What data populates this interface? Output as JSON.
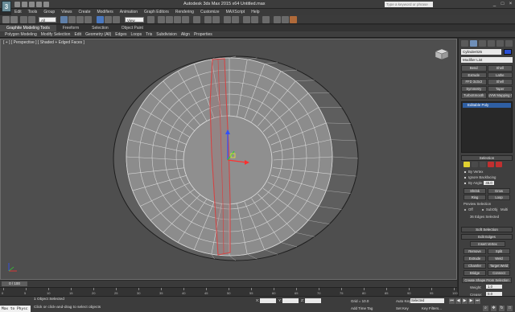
{
  "window": {
    "title": "Autodesk 3ds Max 2015 x64    Untitled.max",
    "search_placeholder": "Type a keyword or phrase",
    "controls": [
      "_",
      "□",
      "×"
    ]
  },
  "menu": [
    "Edit",
    "Tools",
    "Group",
    "Views",
    "Create",
    "Modifiers",
    "Animation",
    "Graph Editors",
    "Rendering",
    "Customize",
    "MAXScript",
    "Help"
  ],
  "toolbar": {
    "selection_filter": "All",
    "view_combo": "View"
  },
  "ribbon": {
    "tabs": [
      "Graphite Modeling Tools",
      "Freeform",
      "Selection",
      "Object Paint"
    ],
    "items": [
      "Polygon Modeling",
      "Modify Selection",
      "Edit",
      "Geometry (All)",
      "Edges",
      "Loops",
      "Tris",
      "Subdivision",
      "Align",
      "Properties"
    ]
  },
  "viewport": {
    "label": "[ + ] [ Perspective ] [ Shaded + Edged Faces ]"
  },
  "command_panel": {
    "object_name": "Cylinder025",
    "modifier_list": "Modifier List",
    "modifier_buttons": [
      "Bend",
      "Shell",
      "Extrude",
      "Lathe",
      "FFD 3x3x3",
      "Shell",
      "Symmetry",
      "Taper",
      "TurboSmooth",
      "UVW Mapping Cle"
    ],
    "stack_item": "Editable Poly",
    "selection_header": "Selection",
    "by_vertex": "By Vertex",
    "ignore_backfacing": "Ignore Backfacing",
    "by_angle": "By Angle:",
    "by_angle_value": "45.0",
    "shrink": "Shrink",
    "grow": "Grow",
    "ring": "Ring",
    "loop": "Loop",
    "preview_selection": "Preview Selection",
    "preview_off": "Off",
    "preview_subobj": "SubObj",
    "preview_multi": "Multi",
    "edges_selected": "36 Edges Selected",
    "soft_selection": "Soft Selection",
    "edit_edges": "Edit Edges",
    "insert_vertex": "Insert Vertex",
    "remove": "Remove",
    "split": "Split",
    "extrude": "Extrude",
    "weld": "Weld",
    "chamfer": "Chamfer",
    "target_weld": "Target Weld",
    "bridge": "Bridge",
    "connect": "Connect",
    "create_shape": "Create Shape From Selection",
    "weight_label": "Weight:",
    "weight_value": "1.0",
    "crease_label": "Crease:",
    "crease_value": "0.0"
  },
  "timeline": {
    "slider": "0 / 100",
    "ticks": [
      "0",
      "5",
      "10",
      "15",
      "20",
      "25",
      "30",
      "35",
      "40",
      "45",
      "50",
      "55",
      "60",
      "65",
      "70",
      "75",
      "80",
      "85",
      "90",
      "95",
      "100"
    ]
  },
  "status": {
    "maxscript": "Max to Physc",
    "object_selected": "1 Object Selected",
    "prompt": "Click or click-and-drag to select objects",
    "x_label": "X:",
    "y_label": "Y:",
    "z_label": "Z:",
    "grid": "Grid = 10.0",
    "auto_key": "Auto Key",
    "selected": "Selected",
    "set_key": "Set Key",
    "key_filters": "Key Filters...",
    "add_time_tag": "Add Time Tag"
  },
  "colors": {
    "viewport_bg": "#4e4e4e",
    "model_face": "#8c8c8c",
    "selected_edge": "#d04040",
    "accent_blue": "#2f5fa3"
  }
}
